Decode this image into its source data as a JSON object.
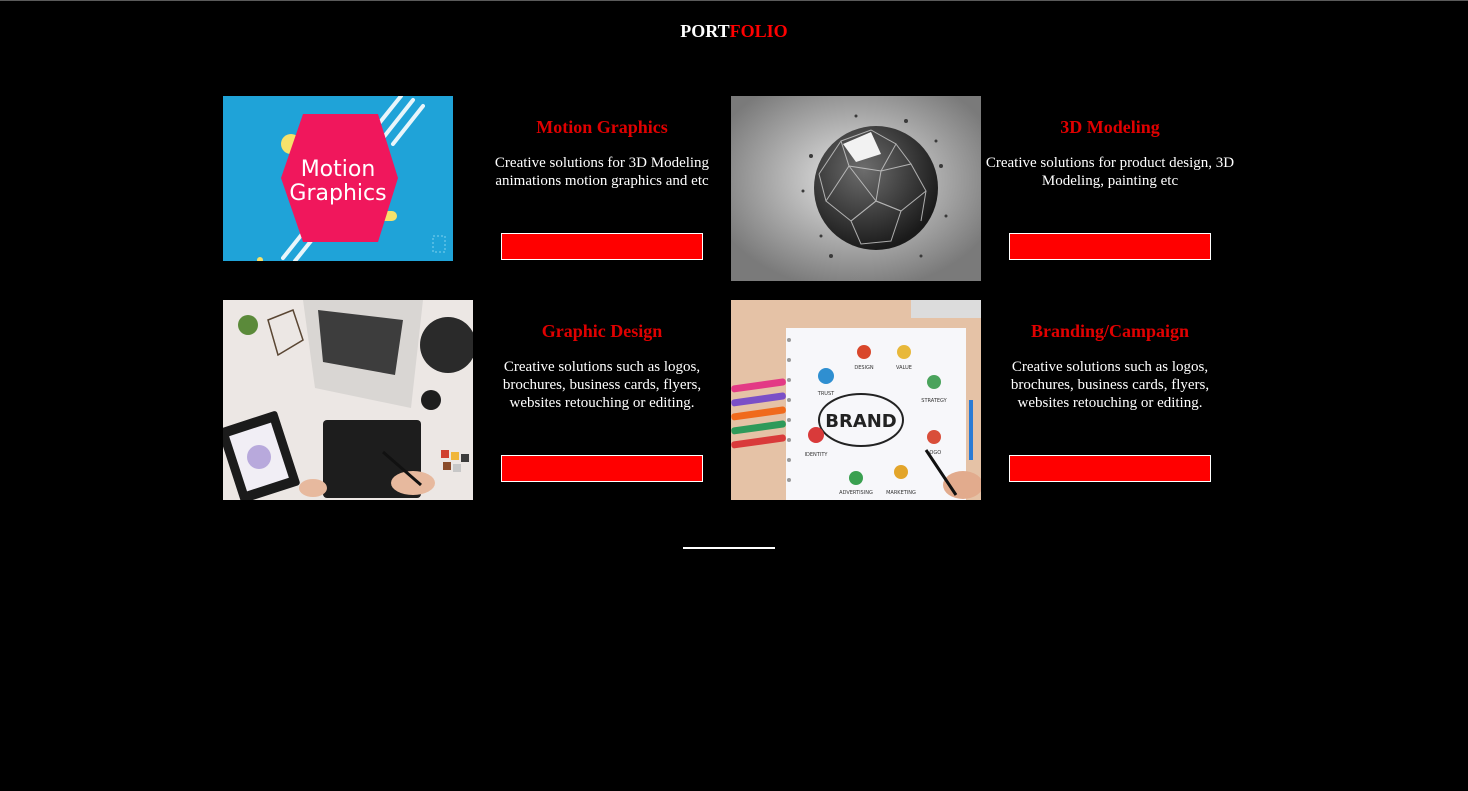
{
  "header": {
    "title_part1": "PORT",
    "title_part2": "FOLIO",
    "accent_color": "#ff0000"
  },
  "cards": [
    {
      "title": "Motion Graphics",
      "description": "Creative solutions for 3D Modeling animations motion graphics and etc",
      "image_text_1": "Motion",
      "image_text_2": "Graphics",
      "button_label": ""
    },
    {
      "title": "3D Modeling",
      "description": "Creative solutions for product design, 3D Modeling, painting etc",
      "button_label": ""
    },
    {
      "title": "Graphic Design",
      "description": "Creative solutions such as logos, brochures, business cards, flyers, websites retouching or editing.",
      "button_label": ""
    },
    {
      "title": "Branding/Campaign",
      "description": "Creative solutions such as logos, brochures, business cards, flyers, websites retouching or editing.",
      "image_text_center": "BRAND",
      "image_labels": [
        "DESIGN",
        "VALUE",
        "TRUST",
        "STRATEGY",
        "IDENTITY",
        "LOGO",
        "ADVERTISING",
        "MARKETING"
      ],
      "button_label": ""
    }
  ]
}
